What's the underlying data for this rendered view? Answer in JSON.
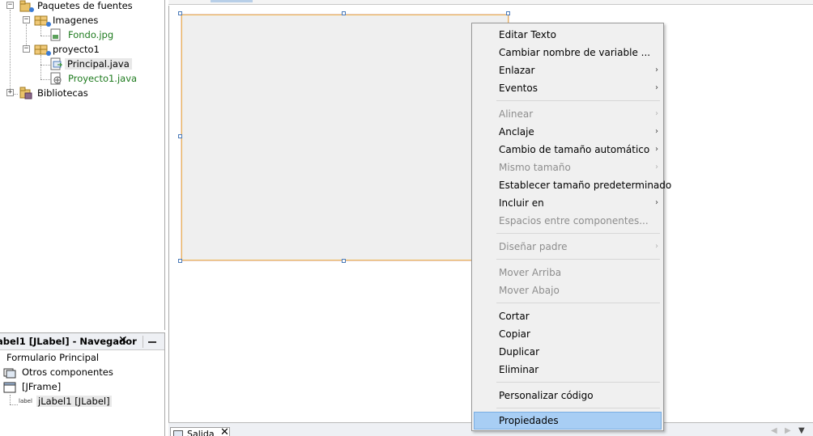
{
  "project_tree": {
    "source_packages": "Paquetes de fuentes",
    "pkg_imagenes": "Imagenes",
    "file_fondo": "Fondo.jpg",
    "pkg_proyecto1": "proyecto1",
    "file_principal": "Principal.java",
    "file_proyecto1": "Proyecto1.java",
    "libraries": "Bibliotecas",
    "expand_minus": "−",
    "expand_plus": "+"
  },
  "navigator": {
    "title": "abel1 [JLabel] - Navegador",
    "close_glyph": "✕",
    "form": "Formulario Principal",
    "other_components": "Otros componentes",
    "jframe": "[JFrame]",
    "jlabel": "jLabel1 [JLabel]",
    "label_icon_text": "label"
  },
  "context_menu": {
    "items": [
      {
        "label": "Editar Texto",
        "enabled": true,
        "submenu": false
      },
      {
        "label": "Cambiar nombre de variable ...",
        "enabled": true,
        "submenu": false
      },
      {
        "label": "Enlazar",
        "enabled": true,
        "submenu": true
      },
      {
        "label": "Eventos",
        "enabled": true,
        "submenu": true
      },
      {
        "label": "Alinear",
        "enabled": false,
        "submenu": true
      },
      {
        "label": "Anclaje",
        "enabled": true,
        "submenu": true
      },
      {
        "label": "Cambio de tamaño automático",
        "enabled": true,
        "submenu": true
      },
      {
        "label": "Mismo tamaño",
        "enabled": false,
        "submenu": true
      },
      {
        "label": "Establecer tamaño predeterminado",
        "enabled": true,
        "submenu": false
      },
      {
        "label": "Incluir en",
        "enabled": true,
        "submenu": true
      },
      {
        "label": "Espacios entre componentes...",
        "enabled": false,
        "submenu": false
      },
      {
        "label": "Diseñar padre",
        "enabled": false,
        "submenu": true
      },
      {
        "label": "Mover Arriba",
        "enabled": false,
        "submenu": false
      },
      {
        "label": "Mover Abajo",
        "enabled": false,
        "submenu": false
      },
      {
        "label": "Cortar",
        "enabled": true,
        "submenu": false
      },
      {
        "label": "Copiar",
        "enabled": true,
        "submenu": false
      },
      {
        "label": "Duplicar",
        "enabled": true,
        "submenu": false
      },
      {
        "label": "Eliminar",
        "enabled": true,
        "submenu": false
      },
      {
        "label": "Personalizar código",
        "enabled": true,
        "submenu": false
      },
      {
        "label": "Propiedades",
        "enabled": true,
        "submenu": false,
        "highlighted": true
      }
    ],
    "submenu_glyph": "›"
  },
  "output": {
    "tab_label": "Salida",
    "close_glyph": "✕",
    "left_arrow": "◀",
    "right_arrow": "▶",
    "menu_arrow": "▼"
  },
  "colors": {
    "selection_highlight": "#a8cef4",
    "label_border": "#f0b858",
    "file_text_green": "#1d7a1d"
  }
}
